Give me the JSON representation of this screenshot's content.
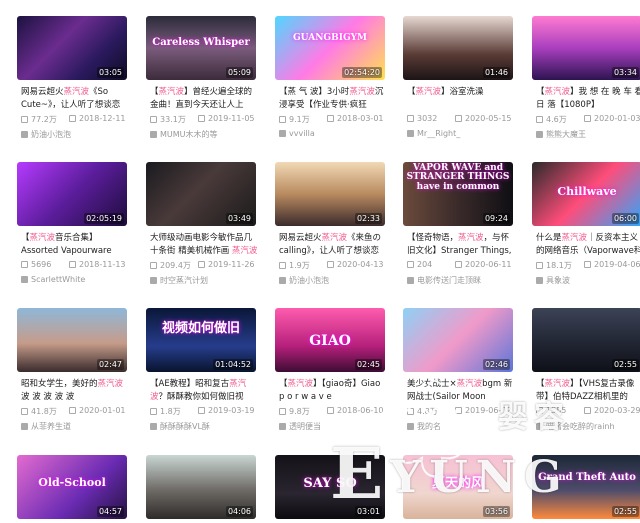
{
  "videos": [
    {
      "duration": "03:05",
      "title_pre": "网易云超火",
      "title_hl": "蒸汽波",
      "title_post": "《So Cute~》，让人听了想谈恋",
      "plays": "77.2万",
      "date": "2018-12-11",
      "uploader": "奶油小泡泡",
      "overlay": ""
    },
    {
      "duration": "05:09",
      "title_pre": "【",
      "title_hl": "蒸汽波",
      "title_post": "】曾经火遍全球的金曲！直到今天还让人上",
      "plays": "33.1万",
      "date": "2019-11-05",
      "uploader": "MUMU木木的等",
      "overlay": "Careless Whisper"
    },
    {
      "duration": "02:54:20",
      "title_pre": "【蒸 气 波】3小时",
      "title_hl": "蒸汽波",
      "title_post": "沉浸享受【作业专供·疯狂",
      "plays": "9.1万",
      "date": "2018-03-01",
      "uploader": "vvvilla",
      "overlay": "GUANGBIGYM"
    },
    {
      "duration": "01:46",
      "title_pre": "【",
      "title_hl": "蒸汽波",
      "title_post": "】浴室洗澡",
      "plays": "3032",
      "date": "2020-05-15",
      "uploader": "Mr__Right_",
      "overlay": ""
    },
    {
      "duration": "03:34",
      "title_pre": "【",
      "title_hl": "蒸汽波",
      "title_post": "】我 想 在 晚 车 看 日 落【1080P】",
      "plays": "4.6万",
      "date": "2020-01-03",
      "uploader": "熊熊大魔王",
      "overlay": ""
    },
    {
      "duration": "02:05:19",
      "title_pre": "【",
      "title_hl": "蒸汽波",
      "title_post": "音乐合集】Assorted Vapourware",
      "plays": "5696",
      "date": "2018-11-13",
      "uploader": "ScarlettWhite",
      "overlay": ""
    },
    {
      "duration": "03:49",
      "title_pre": "大师级动画电影今敏作品几十条街 精美机械作画 ",
      "title_hl": "蒸汽波",
      "title_post": "",
      "plays": "209.4万",
      "date": "2019-11-26",
      "uploader": "时空蒸汽计划",
      "overlay": ""
    },
    {
      "duration": "02:33",
      "title_pre": "网易云超火",
      "title_hl": "蒸汽波",
      "title_post": "《来鱼の calling》，让人听了想谈恋爱",
      "plays": "1.9万",
      "date": "2020-04-13",
      "uploader": "奶油小泡泡",
      "overlay": ""
    },
    {
      "duration": "09:24",
      "title_pre": "【怪奇物语，",
      "title_hl": "蒸汽波",
      "title_post": "，与怀旧文化】Stranger Things,",
      "plays": "204",
      "date": "2020-06-11",
      "uploader": "电影传送门走顶眯",
      "overlay": "VAPOR WAVE and STRANGER THINGS have in common"
    },
    {
      "duration": "06:00",
      "title_pre": "什么是",
      "title_hl": "蒸汽波",
      "title_post": "｜反资本主义的网络音乐（Vaporwave科",
      "plays": "18.1万",
      "date": "2019-04-06",
      "uploader": "具象波",
      "overlay": "Chillwave"
    },
    {
      "duration": "02:47",
      "title_pre": "昭和女学生，美好的",
      "title_hl": "蒸汽波",
      "title_post": " 波 波 波 波 波",
      "plays": "41.8万",
      "date": "2020-01-01",
      "uploader": "从菲养生道",
      "overlay": ""
    },
    {
      "duration": "01:04:52",
      "title_pre": "【AE教程】昭和复古",
      "title_hl": "蒸汽波",
      "title_post": "？酥酥教你如何做旧视",
      "plays": "1.8万",
      "date": "2019-03-19",
      "uploader": "酥酥酥酥VL酥",
      "overlay": "视频如何做旧"
    },
    {
      "duration": "02:45",
      "title_pre": "【",
      "title_hl": "蒸汽波",
      "title_post": "】【giao奇】Giao p o r w a v e",
      "plays": "9.8万",
      "date": "2018-06-10",
      "uploader": "透明便当",
      "overlay": "GIAO"
    },
    {
      "duration": "02:46",
      "title_pre": "美少女战士×",
      "title_hl": "蒸汽波",
      "title_post": "bgm 新网战士(Sailor Moon",
      "plays": "4.8万",
      "date": "2019-06-02",
      "uploader": "我的名",
      "overlay": ""
    },
    {
      "duration": "02:55",
      "title_pre": "【",
      "title_hl": "蒸汽波",
      "title_post": "】【VHS复古录像带】伯特DAZZ相机里的",
      "plays": "1585",
      "date": "2020-03-29",
      "uploader": "喵酱会吃醉的rainh",
      "overlay": ""
    },
    {
      "duration": "04:57",
      "title_pre": "",
      "title_hl": "",
      "title_post": "",
      "plays": "",
      "date": "",
      "uploader": "",
      "overlay": "Old-School"
    },
    {
      "duration": "04:06",
      "title_pre": "",
      "title_hl": "",
      "title_post": "",
      "plays": "",
      "date": "",
      "uploader": "",
      "overlay": ""
    },
    {
      "duration": "03:01",
      "title_pre": "",
      "title_hl": "",
      "title_post": "",
      "plays": "",
      "date": "",
      "uploader": "",
      "overlay": "SAY SO"
    },
    {
      "duration": "03:56",
      "title_pre": "",
      "title_hl": "",
      "title_post": "",
      "plays": "",
      "date": "",
      "uploader": "",
      "overlay": "夏天的风"
    },
    {
      "duration": "02:55",
      "title_pre": "",
      "title_hl": "",
      "title_post": "",
      "plays": "",
      "date": "",
      "uploader": "",
      "overlay": "Grand Theft Auto"
    }
  ],
  "watermark": {
    "big": "EYUNG",
    "cn": "婴容"
  },
  "colors": {
    "highlight": "#f25d8e",
    "meta": "#999999",
    "title": "#212121"
  }
}
